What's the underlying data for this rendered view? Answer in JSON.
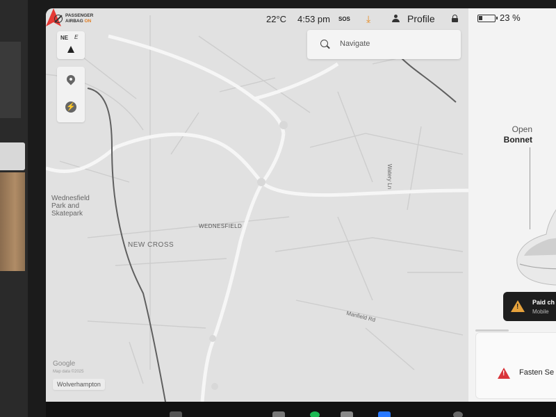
{
  "status_bar": {
    "airbag_line1": "PASSENGER",
    "airbag_line2": "AIRBAG",
    "airbag_state": "ON",
    "temperature": "22°C",
    "time": "4:53 pm",
    "sos": "SOS",
    "profile_label": "Profile",
    "battery_percent": "23 %",
    "battery_level": 0.23
  },
  "navigate": {
    "placeholder": "Navigate"
  },
  "map_controls": {
    "compass_label": "NE",
    "compass_heading_letter": "E"
  },
  "map_labels": {
    "park": "Wednesfield\nPark and\nSkatepark",
    "wednesfield": "WEDNESFIELD",
    "new_cross": "NEW CROSS",
    "manfield_rd": "Manfield Rd",
    "watery_ln": "Watery Ln",
    "google": "Google",
    "map_data": "Map data ©2025",
    "region": "Wolverhampton"
  },
  "vehicle_panel": {
    "open_label": "Open",
    "bonnet_label": "Bonnet",
    "alert_title": "Paid ch",
    "alert_subtitle": "Mobile",
    "seatbelt_text": "Fasten Se"
  },
  "colors": {
    "navigation_arrow": "#e53935",
    "download_accent": "#e68a1f",
    "airbag_on": "#e07b1f",
    "seatbelt_warning": "#d9343a",
    "charging_warning": "#e6a23c"
  }
}
